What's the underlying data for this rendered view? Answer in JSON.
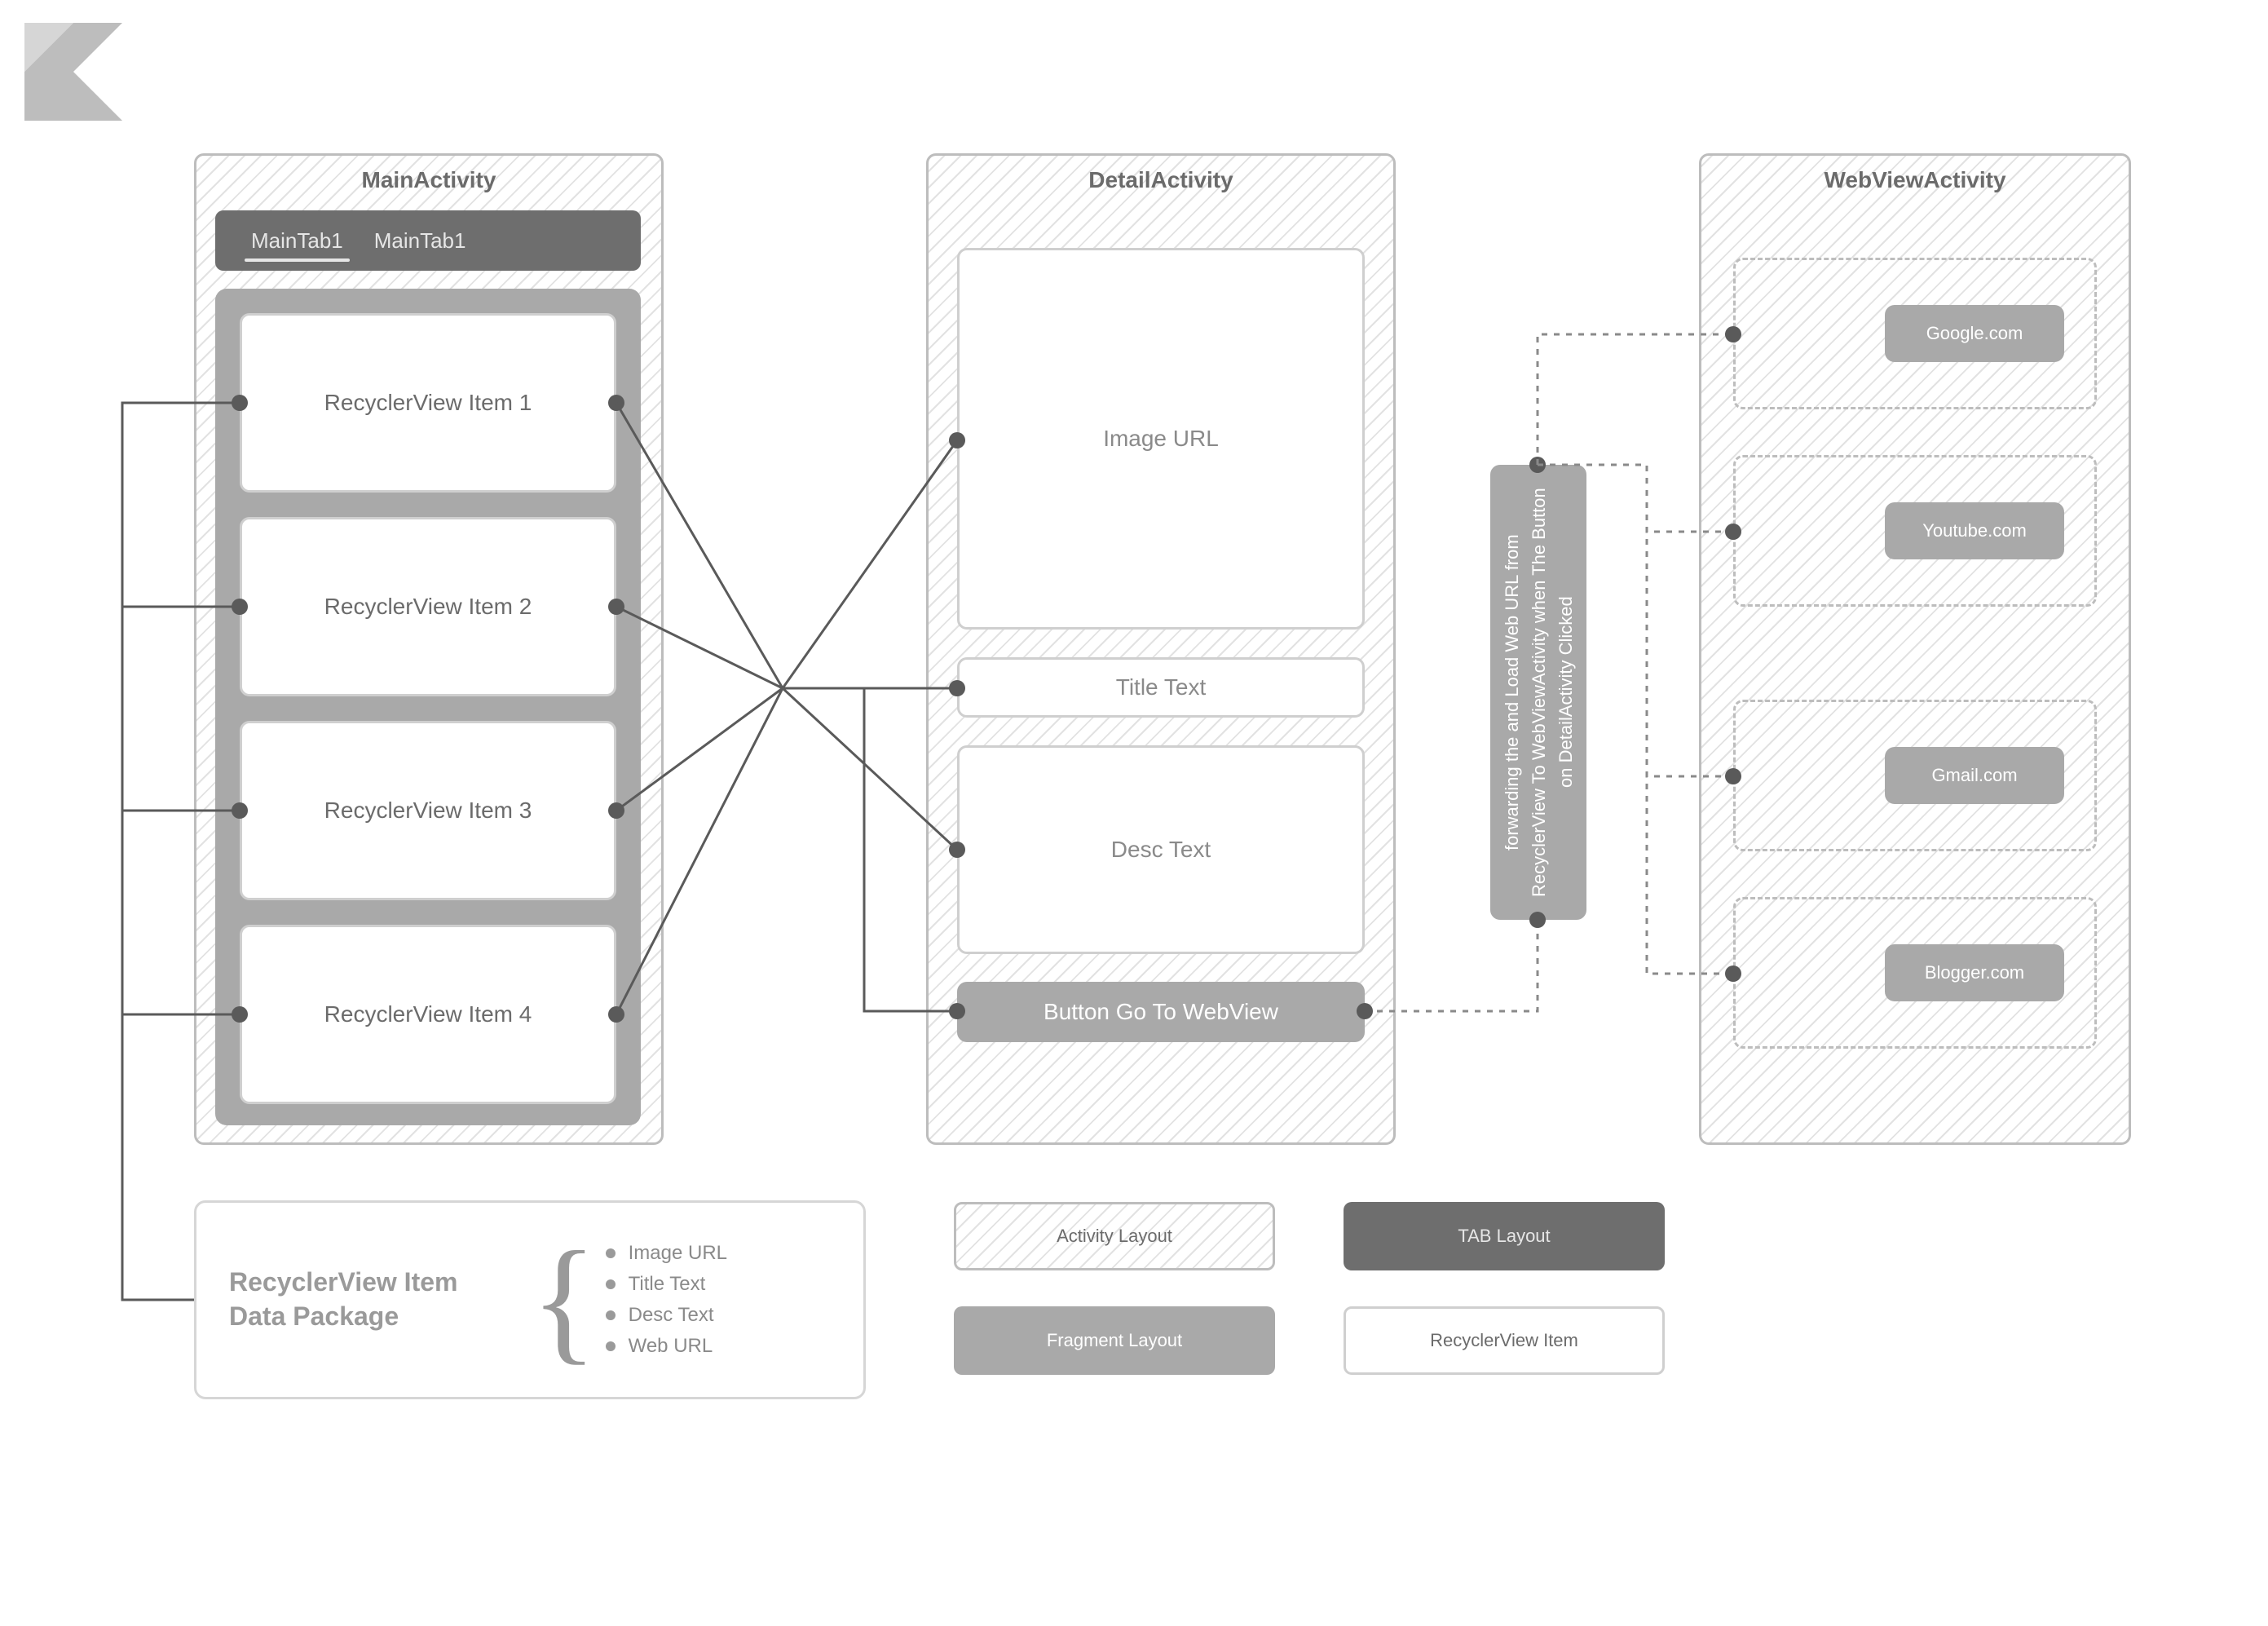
{
  "main_activity": {
    "title": "MainActivity",
    "tabs": [
      "MainTab1",
      "MainTab1"
    ],
    "recycler_items": [
      "RecyclerView Item 1",
      "RecyclerView Item 2",
      "RecyclerView Item 3",
      "RecyclerView Item 4"
    ]
  },
  "detail_activity": {
    "title": "DetailActivity",
    "image_label": "Image URL",
    "title_label": "Title Text",
    "desc_label": "Desc Text",
    "button_label": "Button Go To WebView"
  },
  "webview_activity": {
    "title": "WebViewActivity",
    "targets": [
      "Google.com",
      "Youtube.com",
      "Gmail.com",
      "Blogger.com"
    ]
  },
  "forwarding_text": "forwarding the and Load Web URL from RecyclerView To WebViewActivity when The Button on DetailActivity Clicked",
  "data_package": {
    "title": "RecyclerView Item Data Package",
    "fields": [
      "Image URL",
      "Title Text",
      "Desc Text",
      "Web URL"
    ]
  },
  "legend": {
    "activity_layout": "Activity Layout",
    "tab_layout": "TAB Layout",
    "fragment_layout": "Fragment Layout",
    "recyclerview_item": "RecyclerView Item"
  }
}
